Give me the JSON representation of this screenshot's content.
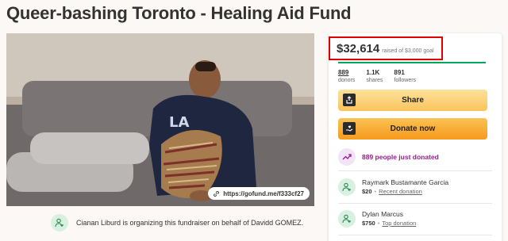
{
  "page": {
    "title": "Queer-bashing Toronto - Healing Aid Fund"
  },
  "photo": {
    "url_label": "https://gofund.me/f333cf27"
  },
  "organizer": {
    "text": "Cianan Liburd is organizing this fundraiser on behalf of Davidd GOMEZ."
  },
  "sidebar": {
    "raised_amount": "$32,614",
    "goal_text": "raised of $3,000 goal",
    "progress_fraction": 1.0,
    "stats": [
      {
        "value": "889",
        "label": "donors"
      },
      {
        "value": "1.1K",
        "label": "shares"
      },
      {
        "value": "891",
        "label": "followers"
      }
    ],
    "share_label": "Share",
    "donate_label": "Donate now",
    "trending_text": "889 people just donated",
    "donations": [
      {
        "name": "Raymark Bustamante Garcia",
        "amount": "$20",
        "tag": "Recent donation"
      },
      {
        "name": "Dylan Marcus",
        "amount": "$750",
        "tag": "Top donation"
      }
    ]
  },
  "colors": {
    "highlight_border": "#e00000",
    "progress": "#02a95c",
    "share_button": "#f9c35c",
    "donate_button": "#f59a1c",
    "trending_text": "#9b1a8f"
  },
  "icons": {
    "share": "share-icon",
    "donate": "donate-icon",
    "link": "link-icon",
    "trending": "trending-up-icon",
    "person": "person-heart-icon"
  }
}
